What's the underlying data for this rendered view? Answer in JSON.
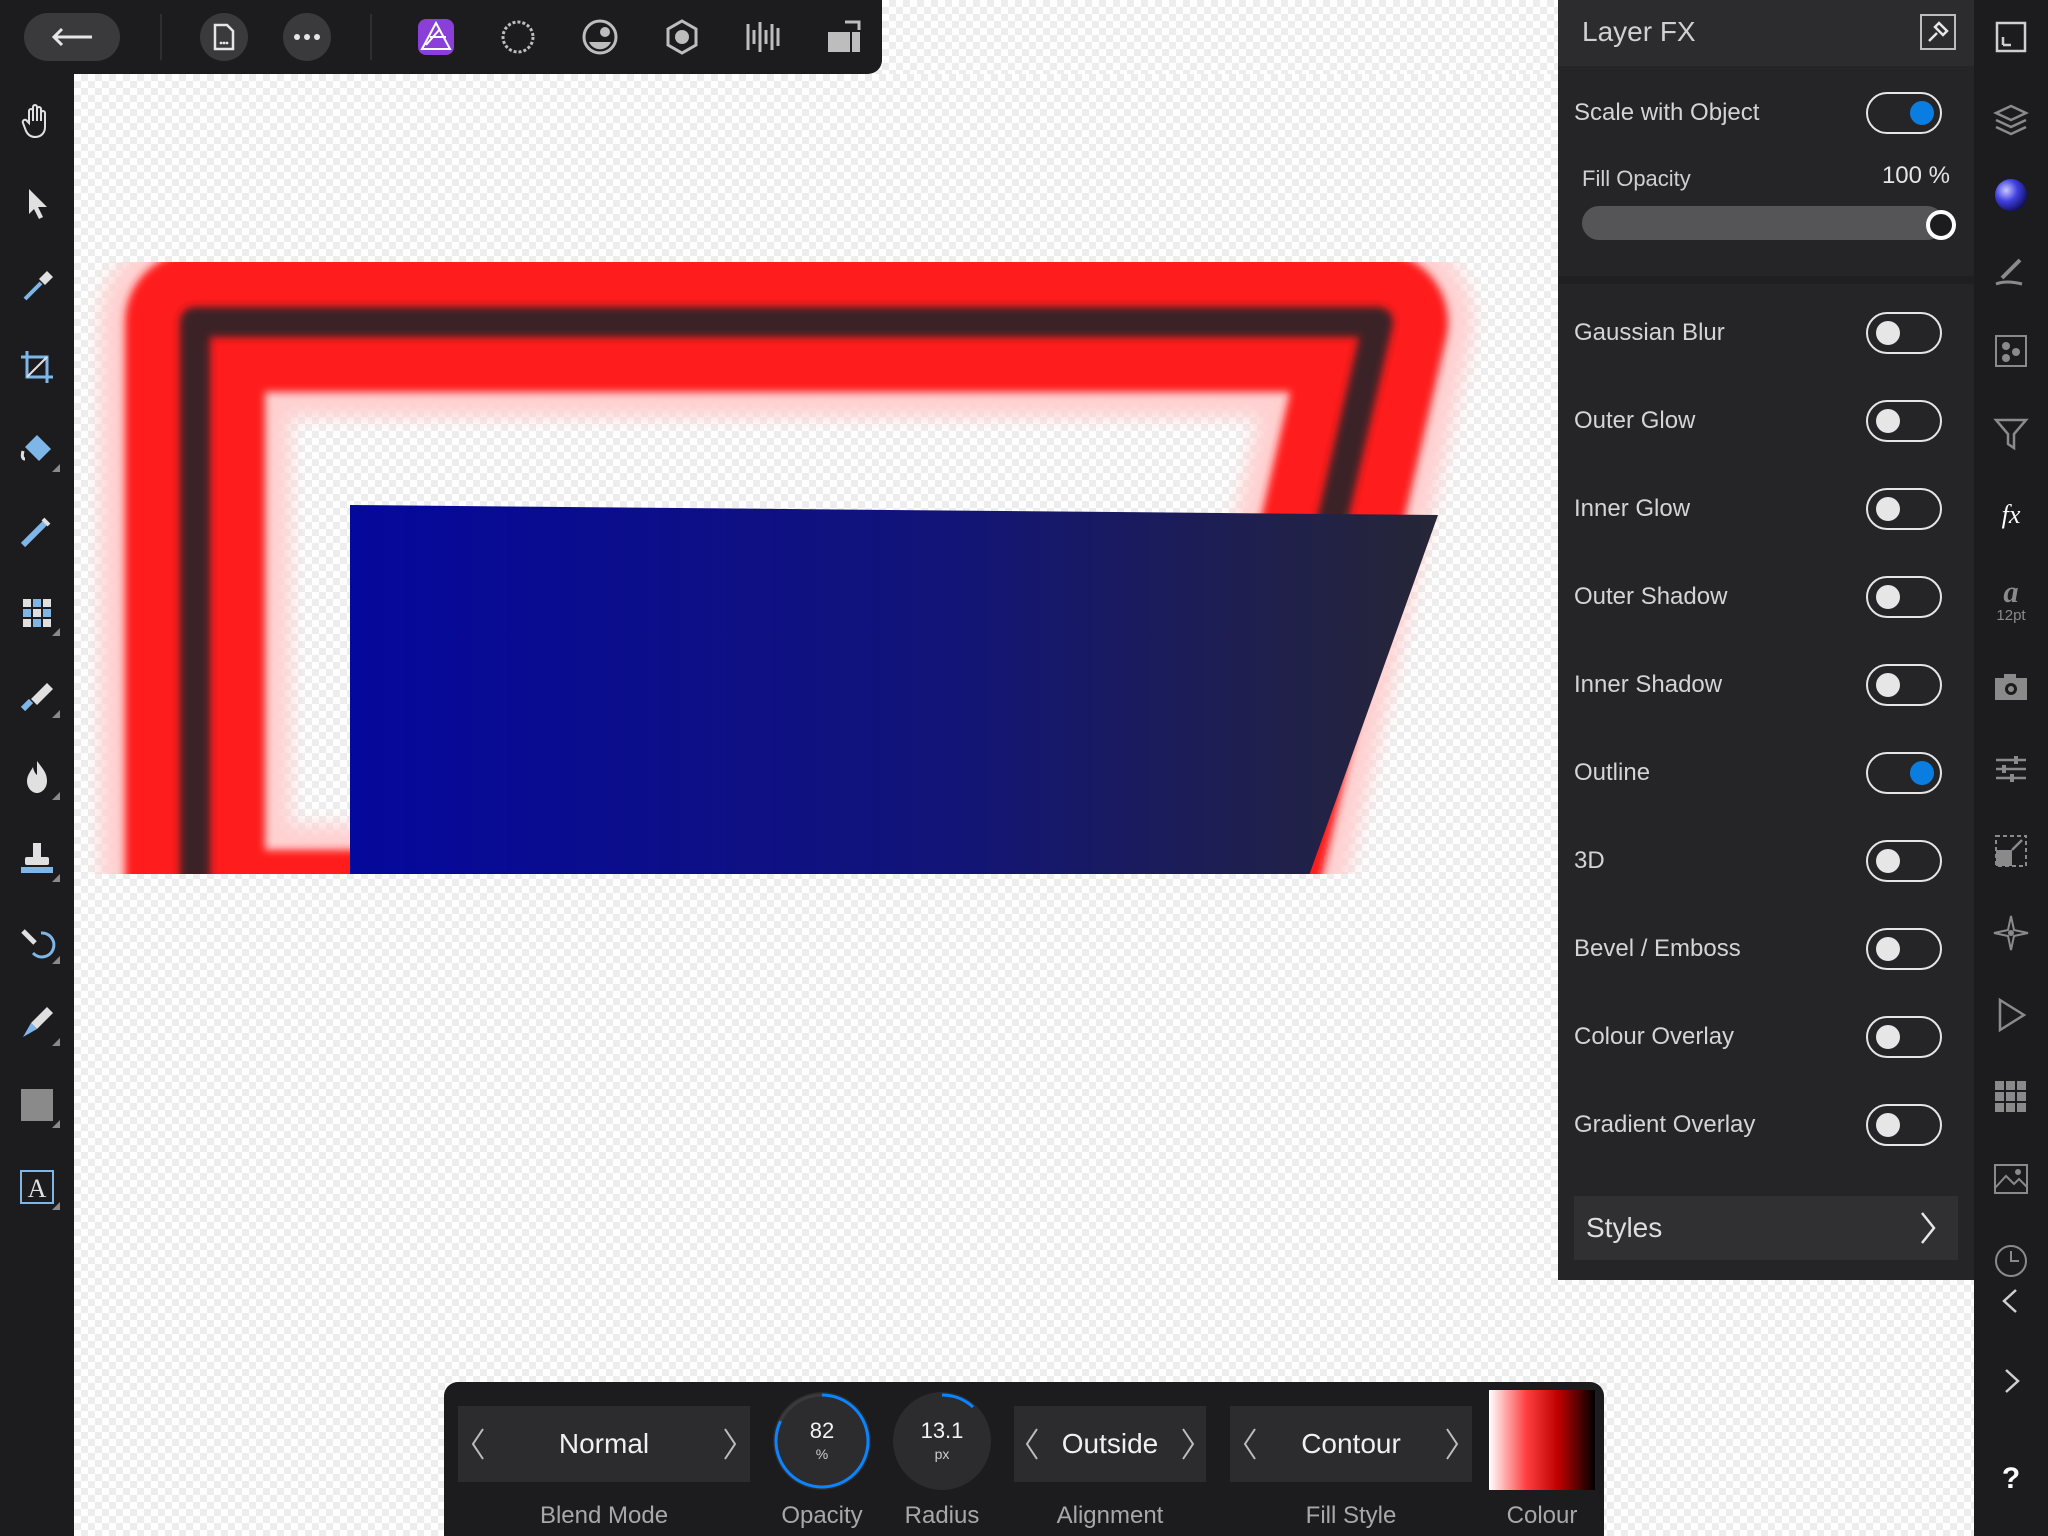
{
  "top_bar": {
    "back_icon": "back-arrow-icon",
    "doc_icon": "document-icon",
    "more_icon": "more-icon",
    "personas": [
      "photo-persona-icon",
      "liquify-persona-icon",
      "develop-persona-icon",
      "tone-mapping-persona-icon",
      "export-persona-icon"
    ],
    "extra": "view-icon"
  },
  "panel": {
    "title": "Layer FX",
    "scale_with_object": {
      "label": "Scale with Object",
      "on": true
    },
    "fill_opacity": {
      "label": "Fill Opacity",
      "value": "100 %",
      "fraction": 1.0
    },
    "effects": [
      {
        "label": "Gaussian Blur",
        "on": false
      },
      {
        "label": "Outer Glow",
        "on": false
      },
      {
        "label": "Inner Glow",
        "on": false
      },
      {
        "label": "Outer Shadow",
        "on": false
      },
      {
        "label": "Inner Shadow",
        "on": false
      },
      {
        "label": "Outline",
        "on": true
      },
      {
        "label": "3D",
        "on": false
      },
      {
        "label": "Bevel / Emboss",
        "on": false
      },
      {
        "label": "Colour Overlay",
        "on": false
      },
      {
        "label": "Gradient Overlay",
        "on": false
      }
    ],
    "styles_label": "Styles"
  },
  "right_bar": {
    "text_size": "12pt"
  },
  "context_bar": {
    "blend_mode": {
      "value": "Normal",
      "label": "Blend Mode"
    },
    "opacity": {
      "value": "82",
      "unit": "%",
      "label": "Opacity",
      "fraction": 0.82
    },
    "radius": {
      "value": "13.1",
      "unit": "px",
      "label": "Radius"
    },
    "alignment": {
      "value": "Outside",
      "label": "Alignment"
    },
    "fill_style": {
      "value": "Contour",
      "label": "Fill Style"
    },
    "colour": {
      "label": "Colour",
      "gradient": [
        "#ffffff",
        "#ff4040",
        "#c00000",
        "#000000"
      ]
    }
  },
  "canvas": {
    "shape_fill": [
      "#05089c",
      "#1a1a4a",
      "#262636"
    ],
    "outline_color": "#ff1e1e"
  },
  "help_label": "?"
}
